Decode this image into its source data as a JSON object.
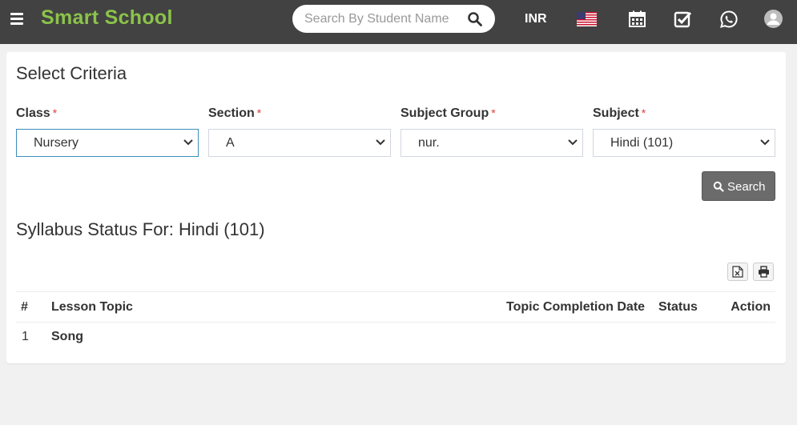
{
  "header": {
    "brand": "Smart School",
    "search_placeholder": "Search By Student Name",
    "currency": "INR"
  },
  "criteria": {
    "title": "Select Criteria",
    "required_mark": "*",
    "fields": [
      {
        "label": "Class",
        "value": "Nursery"
      },
      {
        "label": "Section",
        "value": "A"
      },
      {
        "label": "Subject Group",
        "value": "nur."
      },
      {
        "label": "Subject",
        "value": "Hindi (101)"
      }
    ],
    "search_label": "Search"
  },
  "syllabus": {
    "title": "Syllabus Status For: Hindi (101)",
    "columns": {
      "num": "#",
      "topic": "Lesson Topic",
      "date": "Topic Completion Date",
      "status": "Status",
      "action": "Action"
    },
    "rows": [
      {
        "num": "1",
        "topic": "Song",
        "date": "",
        "status": "",
        "action": ""
      }
    ]
  },
  "colors": {
    "topbar": "#424242",
    "brand": "#8bc34a",
    "search_button": "#6b6b6b",
    "required": "#e03c3c"
  },
  "icons": [
    "menu-icon",
    "search-icon",
    "us-flag-icon",
    "calendar-icon",
    "check-square-icon",
    "whatsapp-icon",
    "user-avatar-icon",
    "chevron-down-icon",
    "excel-icon",
    "print-icon"
  ]
}
